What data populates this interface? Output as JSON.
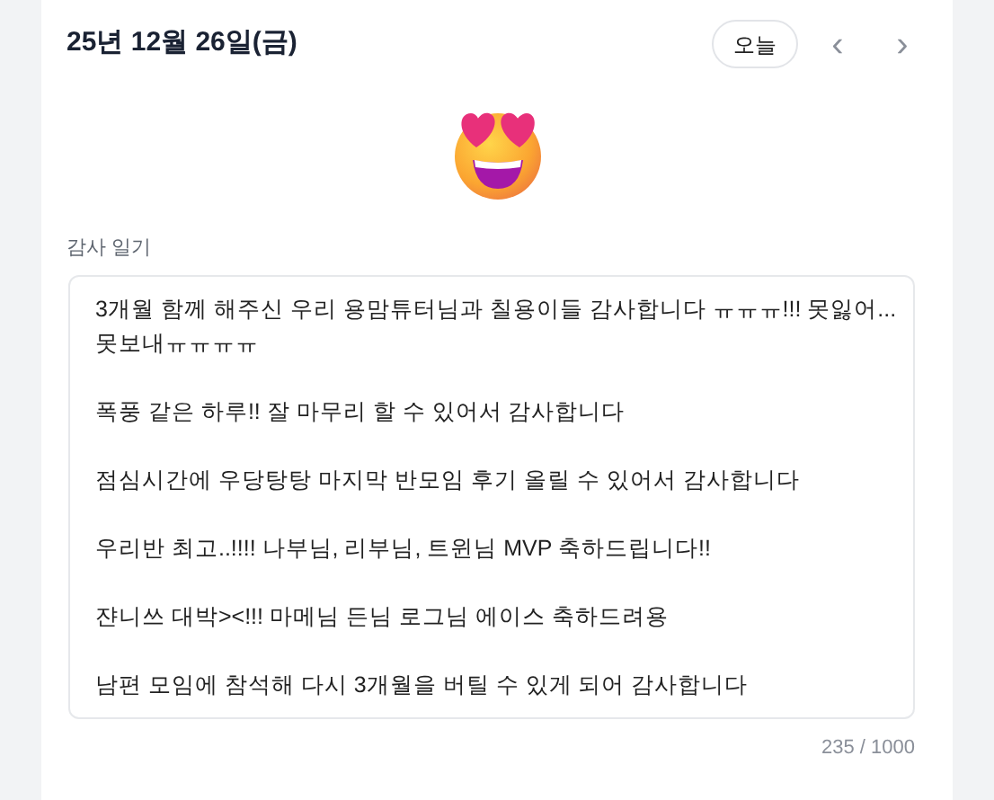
{
  "header": {
    "date": "25년 12월 26일(금)",
    "today_button": "오늘",
    "prev": "‹",
    "next": "›"
  },
  "diary": {
    "label": "감사 일기",
    "value": "3개월 함께 해주신 우리 용맘튜터님과 칠용이들 감사합니다 ㅠㅠㅠ!!! 못잃어...못보내ㅠㅠㅠㅠ\n\n폭풍 같은 하루!! 잘 마무리 할 수 있어서 감사합니다\n\n점심시간에 우당탕탕 마지막 반모임 후기 올릴 수 있어서 감사합니다\n\n우리반 최고..!!!! 나부님, 리부님, 트윈님 MVP 축하드립니다!!\n\n쟌니쓰 대박><!!! 마메님 든님 로그님 에이스 축하드려용\n\n남편 모임에 참석해 다시 3개월을 버틸 수 있게 되어 감사합니다",
    "counter": "235 / 1000"
  }
}
